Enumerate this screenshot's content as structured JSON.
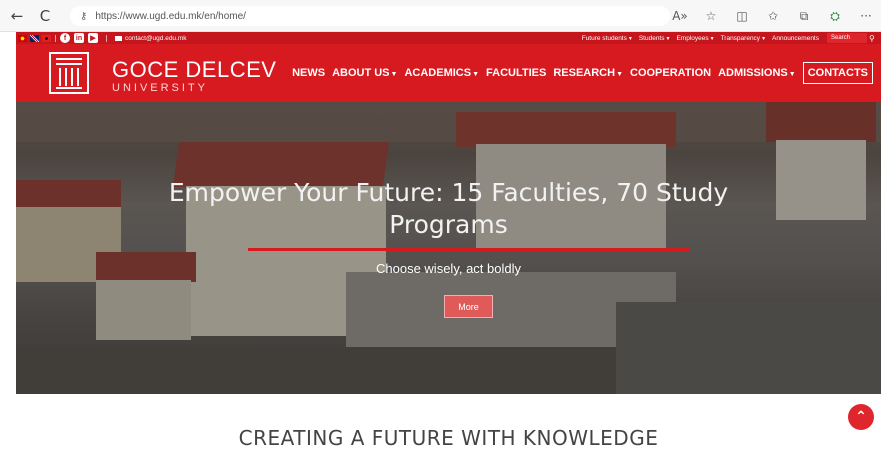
{
  "browser": {
    "url": "https://www.ugd.edu.mk/en/home/",
    "icons": [
      "back-arrow-icon",
      "reload-icon",
      "lock-icon",
      "read-aloud-icon",
      "favorite-star-icon",
      "split-screen-icon",
      "favorites-icon",
      "collections-icon",
      "extension-icon",
      "more-icon"
    ],
    "back": "←",
    "reload": "C",
    "lock": "⚷",
    "read_aloud": "A»",
    "favorite": "☆",
    "split": "◫",
    "favorites": "✩",
    "collections": "⧉",
    "extension": "⛭",
    "more": "···"
  },
  "topbar": {
    "email": "contact@ugd.edu.mk",
    "right_nav": [
      "Future students",
      "Students",
      "Employees",
      "Transparency",
      "Announcements"
    ],
    "search_label": "Search",
    "color": "#c4161c"
  },
  "header": {
    "logo_title": "GOCE DELCEV",
    "logo_subtitle": "UNIVERSITY",
    "nav": [
      {
        "label": "NEWS",
        "dropdown": false
      },
      {
        "label": "ABOUT US",
        "dropdown": true
      },
      {
        "label": "ACADEMICS",
        "dropdown": true
      },
      {
        "label": "FACULTIES",
        "dropdown": false
      },
      {
        "label": "RESEARCH",
        "dropdown": true
      },
      {
        "label": "COOPERATION",
        "dropdown": false
      },
      {
        "label": "ADMISSIONS",
        "dropdown": true
      },
      {
        "label": "CONTACTS",
        "dropdown": false
      }
    ],
    "color": "#d71920"
  },
  "hero": {
    "title_line1": "Empower Your Future: 15 Faculties, 70 Study",
    "title_line2": "Programs",
    "subtitle": "Choose wisely, act boldly",
    "button_label": "More"
  },
  "section": {
    "heading": "CREATING A FUTURE WITH KNOWLEDGE"
  }
}
